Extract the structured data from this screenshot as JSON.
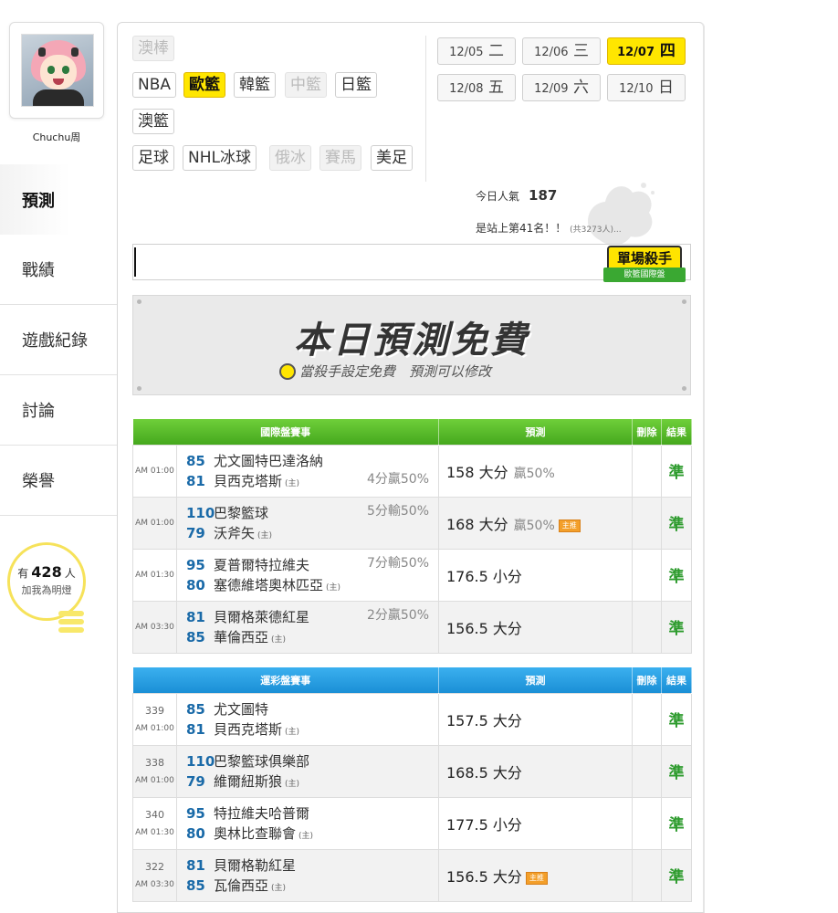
{
  "user": {
    "name": "Chuchu周"
  },
  "nav": [
    "預測",
    "戰績",
    "遊戲紀錄",
    "討論",
    "榮譽"
  ],
  "fans": {
    "prefix": "有",
    "count": "428",
    "suffix": "人",
    "caption": "加我為明燈"
  },
  "categories": [
    {
      "label": "澳棒",
      "state": "dim"
    },
    {
      "label": "NBA",
      "state": "normal"
    },
    {
      "label": "歐籃",
      "state": "selected"
    },
    {
      "label": "韓籃",
      "state": "normal"
    },
    {
      "label": "中籃",
      "state": "dim"
    },
    {
      "label": "日籃",
      "state": "normal"
    },
    {
      "label": "澳籃",
      "state": "normal"
    },
    {
      "label": "足球",
      "state": "normal"
    },
    {
      "label": "NHL冰球",
      "state": "normal"
    },
    {
      "label": "俄冰",
      "state": "dim"
    },
    {
      "label": "賽馬",
      "state": "dim"
    },
    {
      "label": "美足",
      "state": "normal"
    }
  ],
  "dates": [
    {
      "md": "12/05",
      "day": "二",
      "selected": false
    },
    {
      "md": "12/06",
      "day": "三",
      "selected": false
    },
    {
      "md": "12/07",
      "day": "四",
      "selected": true
    },
    {
      "md": "12/08",
      "day": "五",
      "selected": false
    },
    {
      "md": "12/09",
      "day": "六",
      "selected": false
    },
    {
      "md": "12/10",
      "day": "日",
      "selected": false
    }
  ],
  "popularity": {
    "label": "今日人氣",
    "value": "187"
  },
  "rank": {
    "text": "是站上第41名！！",
    "note": "(共3273人)..."
  },
  "badge": {
    "title": "單場殺手",
    "sub": "歐籃國際盤"
  },
  "banner": {
    "title": "本日預測免費",
    "subtitle": "當殺手設定免費　預測可以修改"
  },
  "intl_table": {
    "headers": [
      "國際盤賽事",
      "預測",
      "刪除",
      "結果"
    ],
    "rows": [
      {
        "time": "AM 01:00",
        "away_score": "85",
        "away": "尤文圖特巴達洛納",
        "home_score": "81",
        "home": "貝西克塔斯",
        "home_mark": "(主)",
        "spread": "4分贏50%",
        "pred": "158 大分",
        "rate": "贏50%",
        "tag": "",
        "result": "準"
      },
      {
        "time": "AM 01:00",
        "away_score": "110",
        "away": "巴黎籃球",
        "home_score": "79",
        "home": "沃斧矢",
        "home_mark": "(主)",
        "spread": "5分輸50%",
        "pred": "168 大分",
        "rate": "贏50%",
        "tag": "主推",
        "result": "準"
      },
      {
        "time": "AM 01:30",
        "away_score": "95",
        "away": "夏普爾特拉維夫",
        "home_score": "80",
        "home": "塞德維塔奧林匹亞",
        "home_mark": "(主)",
        "spread": "7分輸50%",
        "pred": "176.5 小分",
        "rate": "",
        "tag": "",
        "result": "準"
      },
      {
        "time": "AM 03:30",
        "away_score": "81",
        "away": "貝爾格萊德紅星",
        "home_score": "85",
        "home": "華倫西亞",
        "home_mark": "(主)",
        "spread": "2分贏50%",
        "pred": "156.5 大分",
        "rate": "",
        "tag": "",
        "result": "準"
      }
    ]
  },
  "lottery_table": {
    "headers": [
      "運彩盤賽事",
      "預測",
      "刪除",
      "結果"
    ],
    "rows": [
      {
        "no": "339",
        "time": "AM 01:00",
        "away_score": "85",
        "away": "尤文圖特",
        "home_score": "81",
        "home": "貝西克塔斯",
        "home_mark": "(主)",
        "pred": "157.5 大分",
        "tag": "",
        "result": "準"
      },
      {
        "no": "338",
        "time": "AM 01:00",
        "away_score": "110",
        "away": "巴黎籃球俱樂部",
        "home_score": "79",
        "home": "維爾紐斯狼",
        "home_mark": "(主)",
        "pred": "168.5 大分",
        "tag": "",
        "result": "準"
      },
      {
        "no": "340",
        "time": "AM 01:30",
        "away_score": "95",
        "away": "特拉維夫哈普爾",
        "home_score": "80",
        "home": "奧林比查聯會",
        "home_mark": "(主)",
        "pred": "177.5 小分",
        "tag": "",
        "result": "準"
      },
      {
        "no": "322",
        "time": "AM 03:30",
        "away_score": "81",
        "away": "貝爾格勒紅星",
        "home_score": "85",
        "home": "瓦倫西亞",
        "home_mark": "(主)",
        "pred": "156.5 大分",
        "tag": "主推",
        "result": "準"
      }
    ]
  }
}
